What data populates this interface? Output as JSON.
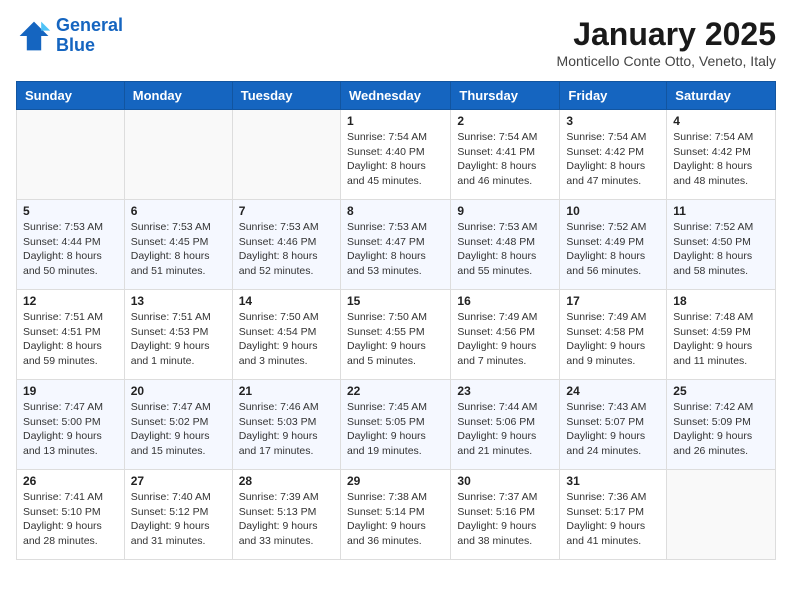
{
  "header": {
    "logo_line1": "General",
    "logo_line2": "Blue",
    "month": "January 2025",
    "location": "Monticello Conte Otto, Veneto, Italy"
  },
  "weekdays": [
    "Sunday",
    "Monday",
    "Tuesday",
    "Wednesday",
    "Thursday",
    "Friday",
    "Saturday"
  ],
  "weeks": [
    [
      {
        "day": "",
        "info": ""
      },
      {
        "day": "",
        "info": ""
      },
      {
        "day": "",
        "info": ""
      },
      {
        "day": "1",
        "info": "Sunrise: 7:54 AM\nSunset: 4:40 PM\nDaylight: 8 hours and 45 minutes."
      },
      {
        "day": "2",
        "info": "Sunrise: 7:54 AM\nSunset: 4:41 PM\nDaylight: 8 hours and 46 minutes."
      },
      {
        "day": "3",
        "info": "Sunrise: 7:54 AM\nSunset: 4:42 PM\nDaylight: 8 hours and 47 minutes."
      },
      {
        "day": "4",
        "info": "Sunrise: 7:54 AM\nSunset: 4:42 PM\nDaylight: 8 hours and 48 minutes."
      }
    ],
    [
      {
        "day": "5",
        "info": "Sunrise: 7:53 AM\nSunset: 4:44 PM\nDaylight: 8 hours and 50 minutes."
      },
      {
        "day": "6",
        "info": "Sunrise: 7:53 AM\nSunset: 4:45 PM\nDaylight: 8 hours and 51 minutes."
      },
      {
        "day": "7",
        "info": "Sunrise: 7:53 AM\nSunset: 4:46 PM\nDaylight: 8 hours and 52 minutes."
      },
      {
        "day": "8",
        "info": "Sunrise: 7:53 AM\nSunset: 4:47 PM\nDaylight: 8 hours and 53 minutes."
      },
      {
        "day": "9",
        "info": "Sunrise: 7:53 AM\nSunset: 4:48 PM\nDaylight: 8 hours and 55 minutes."
      },
      {
        "day": "10",
        "info": "Sunrise: 7:52 AM\nSunset: 4:49 PM\nDaylight: 8 hours and 56 minutes."
      },
      {
        "day": "11",
        "info": "Sunrise: 7:52 AM\nSunset: 4:50 PM\nDaylight: 8 hours and 58 minutes."
      }
    ],
    [
      {
        "day": "12",
        "info": "Sunrise: 7:51 AM\nSunset: 4:51 PM\nDaylight: 8 hours and 59 minutes."
      },
      {
        "day": "13",
        "info": "Sunrise: 7:51 AM\nSunset: 4:53 PM\nDaylight: 9 hours and 1 minute."
      },
      {
        "day": "14",
        "info": "Sunrise: 7:50 AM\nSunset: 4:54 PM\nDaylight: 9 hours and 3 minutes."
      },
      {
        "day": "15",
        "info": "Sunrise: 7:50 AM\nSunset: 4:55 PM\nDaylight: 9 hours and 5 minutes."
      },
      {
        "day": "16",
        "info": "Sunrise: 7:49 AM\nSunset: 4:56 PM\nDaylight: 9 hours and 7 minutes."
      },
      {
        "day": "17",
        "info": "Sunrise: 7:49 AM\nSunset: 4:58 PM\nDaylight: 9 hours and 9 minutes."
      },
      {
        "day": "18",
        "info": "Sunrise: 7:48 AM\nSunset: 4:59 PM\nDaylight: 9 hours and 11 minutes."
      }
    ],
    [
      {
        "day": "19",
        "info": "Sunrise: 7:47 AM\nSunset: 5:00 PM\nDaylight: 9 hours and 13 minutes."
      },
      {
        "day": "20",
        "info": "Sunrise: 7:47 AM\nSunset: 5:02 PM\nDaylight: 9 hours and 15 minutes."
      },
      {
        "day": "21",
        "info": "Sunrise: 7:46 AM\nSunset: 5:03 PM\nDaylight: 9 hours and 17 minutes."
      },
      {
        "day": "22",
        "info": "Sunrise: 7:45 AM\nSunset: 5:05 PM\nDaylight: 9 hours and 19 minutes."
      },
      {
        "day": "23",
        "info": "Sunrise: 7:44 AM\nSunset: 5:06 PM\nDaylight: 9 hours and 21 minutes."
      },
      {
        "day": "24",
        "info": "Sunrise: 7:43 AM\nSunset: 5:07 PM\nDaylight: 9 hours and 24 minutes."
      },
      {
        "day": "25",
        "info": "Sunrise: 7:42 AM\nSunset: 5:09 PM\nDaylight: 9 hours and 26 minutes."
      }
    ],
    [
      {
        "day": "26",
        "info": "Sunrise: 7:41 AM\nSunset: 5:10 PM\nDaylight: 9 hours and 28 minutes."
      },
      {
        "day": "27",
        "info": "Sunrise: 7:40 AM\nSunset: 5:12 PM\nDaylight: 9 hours and 31 minutes."
      },
      {
        "day": "28",
        "info": "Sunrise: 7:39 AM\nSunset: 5:13 PM\nDaylight: 9 hours and 33 minutes."
      },
      {
        "day": "29",
        "info": "Sunrise: 7:38 AM\nSunset: 5:14 PM\nDaylight: 9 hours and 36 minutes."
      },
      {
        "day": "30",
        "info": "Sunrise: 7:37 AM\nSunset: 5:16 PM\nDaylight: 9 hours and 38 minutes."
      },
      {
        "day": "31",
        "info": "Sunrise: 7:36 AM\nSunset: 5:17 PM\nDaylight: 9 hours and 41 minutes."
      },
      {
        "day": "",
        "info": ""
      }
    ]
  ]
}
